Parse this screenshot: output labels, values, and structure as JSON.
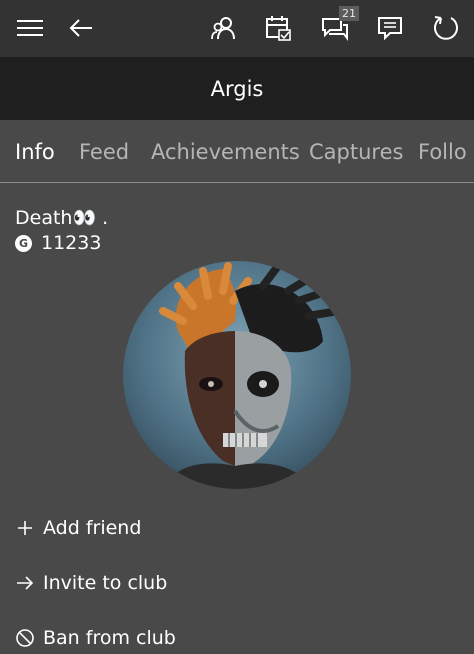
{
  "header": {
    "menu_icon": "hamburger-icon",
    "back_icon": "back-arrow-icon",
    "friends_icon": "people-icon",
    "events_icon": "calendar-icon",
    "messages_icon": "chat-icon",
    "messages_badge": "21",
    "notifications_icon": "notification-icon",
    "refresh_icon": "refresh-icon"
  },
  "title": "Argis",
  "tabs": [
    {
      "label": "Info",
      "active": true
    },
    {
      "label": "Feed",
      "active": false
    },
    {
      "label": "Achievements",
      "active": false
    },
    {
      "label": "Captures",
      "active": false
    },
    {
      "label": "Follo",
      "active": false
    }
  ],
  "profile": {
    "gamertag": "Death👀 .",
    "gamerscore_icon": "G",
    "gamerscore": "11233"
  },
  "actions": [
    {
      "label": "Add friend",
      "icon": "plus-icon"
    },
    {
      "label": "Invite to club",
      "icon": "arrow-right-icon"
    },
    {
      "label": "Ban from club",
      "icon": "block-icon"
    }
  ],
  "colors": {
    "topbar": "#333333",
    "titlebar": "#1f1f1f",
    "background": "#4a4949",
    "inactive_tab": "#b5b5b5"
  }
}
